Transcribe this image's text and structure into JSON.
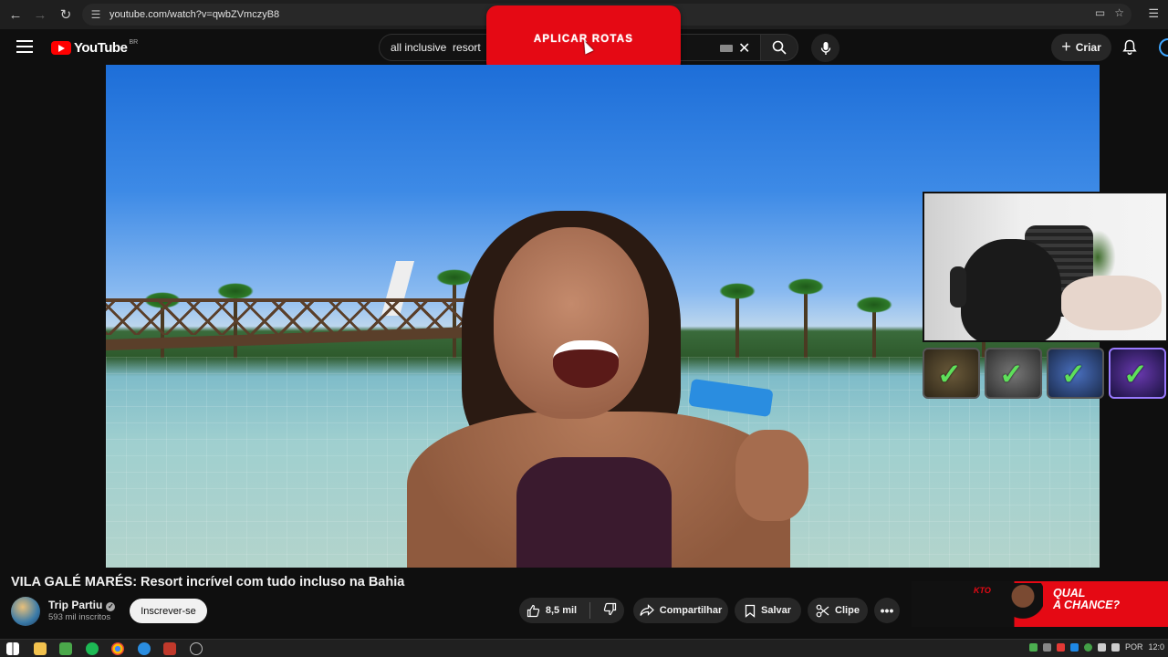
{
  "browser": {
    "url": "youtube.com/watch?v=qwbZVmczyB8"
  },
  "header": {
    "logo_text": "YouTube",
    "region": "BR",
    "search_value": "all inclusive  resort",
    "create_label": "Criar"
  },
  "overlay": {
    "button_label": "APLICAR ROTAS"
  },
  "video": {
    "title": "VILA GALÉ MARÉS: Resort incrível com tudo incluso na Bahia",
    "channel_name": "Trip Partiu",
    "subscribers": "593 mil inscritos",
    "subscribe_label": "Inscrever-se",
    "likes": "8,5 mil",
    "share_label": "Compartilhar",
    "save_label": "Salvar",
    "clip_label": "Clipe",
    "more_label": "•••"
  },
  "ad": {
    "brand": "KTO",
    "headline_line1": "QUAL",
    "headline_line2": "A CHANCE?"
  },
  "taskbar": {
    "language": "POR",
    "clock": "12:0"
  },
  "colors": {
    "accent_red": "#e50914",
    "youtube_red": "#ff0000",
    "check_green": "#5ee05a"
  }
}
